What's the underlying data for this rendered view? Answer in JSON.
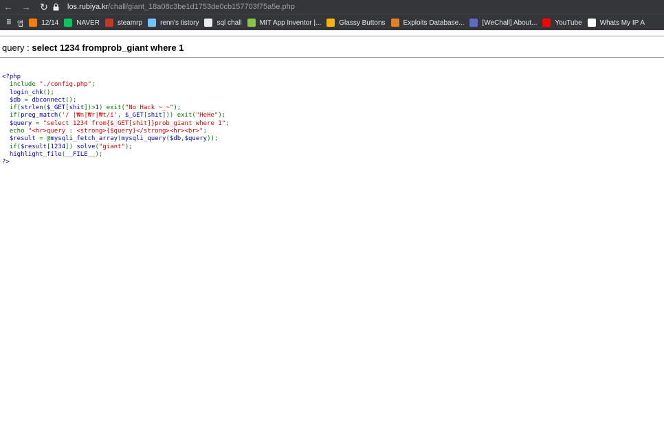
{
  "browser": {
    "url_host": "los.rubiya.kr",
    "url_path": "/chall/giant_18a08c3be1d1753de0cb157703f75a5e.php",
    "bookmarks": [
      {
        "label": "앱",
        "icon": "apps-grid-icon",
        "color": "#e8eaed"
      },
      {
        "label": "12/14",
        "icon": "blogger-icon",
        "color": "#f57d00"
      },
      {
        "label": "NAVER",
        "icon": "naver-icon",
        "color": "#03c75a"
      },
      {
        "label": "steamrp",
        "icon": "steamrp-icon",
        "color": "#c0392b"
      },
      {
        "label": "renn's tistory",
        "icon": "tistory-icon",
        "color": "#6fc3ff"
      },
      {
        "label": "sql chall",
        "icon": "z-icon",
        "color": "#e8eaed"
      },
      {
        "label": "MIT App Inventor |...",
        "icon": "mit-app-inventor-icon",
        "color": "#8bc34a"
      },
      {
        "label": "Glassy Buttons",
        "icon": "glassy-buttons-icon",
        "color": "#f4b400"
      },
      {
        "label": "Exploits Database...",
        "icon": "exploit-db-icon",
        "color": "#e67e22"
      },
      {
        "label": "[WeChall] About...",
        "icon": "wechall-icon",
        "color": "#5c6bc0"
      },
      {
        "label": "YouTube",
        "icon": "youtube-icon",
        "color": "#ff0000"
      },
      {
        "label": "Whats My IP A",
        "icon": "whatsmyip-icon",
        "color": "#ffffff"
      }
    ]
  },
  "page": {
    "query_label": "query : ",
    "query_value": "select 1234 fromprob_giant where 1"
  },
  "source_code": {
    "lines": [
      [
        {
          "c": "tg",
          "t": "<?php"
        }
      ],
      [
        {
          "c": "df",
          "t": "  "
        },
        {
          "c": "kw",
          "t": "include "
        },
        {
          "c": "st",
          "t": "\"./config.php\""
        },
        {
          "c": "kw",
          "t": ";"
        }
      ],
      [
        {
          "c": "df",
          "t": "  login_chk"
        },
        {
          "c": "kw",
          "t": "();"
        }
      ],
      [
        {
          "c": "df",
          "t": "  $db "
        },
        {
          "c": "kw",
          "t": "= "
        },
        {
          "c": "df",
          "t": "dbconnect"
        },
        {
          "c": "kw",
          "t": "();"
        }
      ],
      [
        {
          "c": "df",
          "t": "  "
        },
        {
          "c": "kw",
          "t": "if("
        },
        {
          "c": "df",
          "t": "strlen"
        },
        {
          "c": "kw",
          "t": "("
        },
        {
          "c": "df",
          "t": "$_GET"
        },
        {
          "c": "kw",
          "t": "["
        },
        {
          "c": "df",
          "t": "shit"
        },
        {
          "c": "kw",
          "t": "])>"
        },
        {
          "c": "df",
          "t": "1"
        },
        {
          "c": "kw",
          "t": ") exit("
        },
        {
          "c": "st",
          "t": "\"No Hack ~_~\""
        },
        {
          "c": "kw",
          "t": ");"
        }
      ],
      [
        {
          "c": "df",
          "t": "  "
        },
        {
          "c": "kw",
          "t": "if("
        },
        {
          "c": "df",
          "t": "preg_match"
        },
        {
          "c": "kw",
          "t": "("
        },
        {
          "c": "st",
          "t": "'/ |₩n|₩r|₩t/i'"
        },
        {
          "c": "kw",
          "t": ", "
        },
        {
          "c": "df",
          "t": "$_GET"
        },
        {
          "c": "kw",
          "t": "["
        },
        {
          "c": "df",
          "t": "shit"
        },
        {
          "c": "kw",
          "t": "])) exit("
        },
        {
          "c": "st",
          "t": "\"HeHe\""
        },
        {
          "c": "kw",
          "t": ");"
        }
      ],
      [
        {
          "c": "df",
          "t": "  $query "
        },
        {
          "c": "kw",
          "t": "= "
        },
        {
          "c": "st",
          "t": "\"select 1234 from{$_GET[shit]}prob_giant where 1\""
        },
        {
          "c": "kw",
          "t": ";"
        }
      ],
      [
        {
          "c": "df",
          "t": "  "
        },
        {
          "c": "kw",
          "t": "echo "
        },
        {
          "c": "st",
          "t": "\"<hr>query : <strong>{$query}</strong><hr><br>\""
        },
        {
          "c": "kw",
          "t": ";"
        }
      ],
      [
        {
          "c": "df",
          "t": "  $result "
        },
        {
          "c": "kw",
          "t": "= @"
        },
        {
          "c": "df",
          "t": "mysqli_fetch_array"
        },
        {
          "c": "kw",
          "t": "("
        },
        {
          "c": "df",
          "t": "mysqli_query"
        },
        {
          "c": "kw",
          "t": "("
        },
        {
          "c": "df",
          "t": "$db"
        },
        {
          "c": "kw",
          "t": ","
        },
        {
          "c": "df",
          "t": "$query"
        },
        {
          "c": "kw",
          "t": "));"
        }
      ],
      [
        {
          "c": "df",
          "t": "  "
        },
        {
          "c": "kw",
          "t": "if("
        },
        {
          "c": "df",
          "t": "$result"
        },
        {
          "c": "kw",
          "t": "["
        },
        {
          "c": "df",
          "t": "1234"
        },
        {
          "c": "kw",
          "t": "]) "
        },
        {
          "c": "df",
          "t": "solve"
        },
        {
          "c": "kw",
          "t": "("
        },
        {
          "c": "st",
          "t": "\"giant\""
        },
        {
          "c": "kw",
          "t": ");"
        }
      ],
      [
        {
          "c": "df",
          "t": "  highlight_file"
        },
        {
          "c": "kw",
          "t": "("
        },
        {
          "c": "df",
          "t": "__FILE__"
        },
        {
          "c": "kw",
          "t": ");"
        }
      ],
      [
        {
          "c": "tg",
          "t": "?>"
        }
      ]
    ]
  }
}
